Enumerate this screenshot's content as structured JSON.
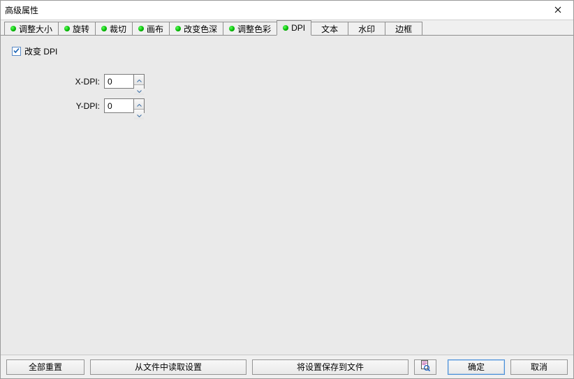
{
  "title": "高级属性",
  "tabs": [
    {
      "label": "调整大小",
      "dot": true,
      "active": false
    },
    {
      "label": "旋转",
      "dot": true,
      "active": false
    },
    {
      "label": "裁切",
      "dot": true,
      "active": false
    },
    {
      "label": "画布",
      "dot": true,
      "active": false
    },
    {
      "label": "改变色深",
      "dot": true,
      "active": false
    },
    {
      "label": "调整色彩",
      "dot": true,
      "active": false
    },
    {
      "label": "DPI",
      "dot": true,
      "active": true
    },
    {
      "label": "文本",
      "dot": false,
      "active": false
    },
    {
      "label": "水印",
      "dot": false,
      "active": false
    },
    {
      "label": "边框",
      "dot": false,
      "active": false
    }
  ],
  "panel": {
    "change_dpi_label": "改变 DPI",
    "change_dpi_checked": true,
    "xdpi_label": "X-DPI:",
    "xdpi_value": "0",
    "ydpi_label": "Y-DPI:",
    "ydpi_value": "0"
  },
  "buttons": {
    "reset": "全部重置",
    "load": "从文件中读取设置",
    "save": "将设置保存到文件",
    "ok": "确定",
    "cancel": "取消"
  }
}
